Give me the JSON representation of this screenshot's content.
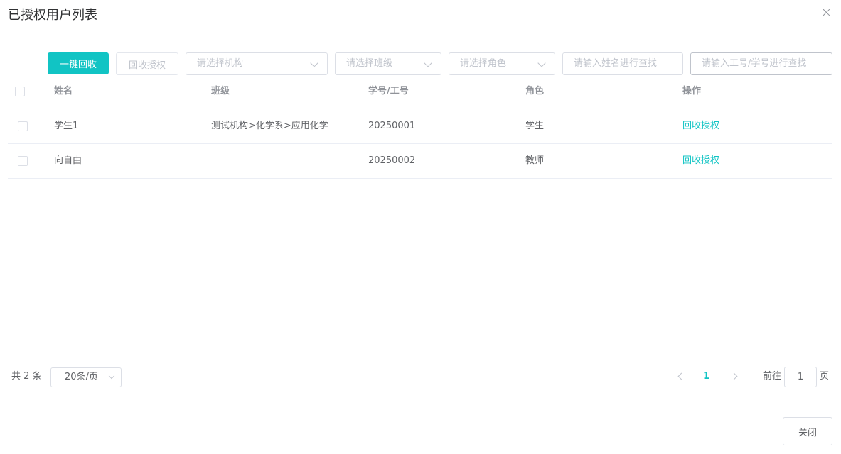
{
  "dialog": {
    "title": "已授权用户列表",
    "close_icon": "close-icon"
  },
  "toolbar": {
    "bulk_revoke_label": "一键回收",
    "revoke_label": "回收授权",
    "org_placeholder": "请选择机构",
    "class_placeholder": "请选择班级",
    "role_placeholder": "请选择角色",
    "name_search_placeholder": "请输入姓名进行查找",
    "id_search_placeholder": "请输入工号/学号进行查找"
  },
  "table": {
    "headers": {
      "name": "姓名",
      "class": "班级",
      "id": "学号/工号",
      "role": "角色",
      "action": "操作"
    },
    "rows": [
      {
        "name": "学生1",
        "class": "测试机构>化学系>应用化学",
        "id": "20250001",
        "role": "学生",
        "action": "回收授权"
      },
      {
        "name": "向自由",
        "class": "",
        "id": "20250002",
        "role": "教师",
        "action": "回收授权"
      }
    ]
  },
  "pagination": {
    "total_label": "共 2 条",
    "page_size": "20条/页",
    "current_page": "1",
    "goto_prefix": "前往",
    "goto_value": "1",
    "goto_suffix": "页"
  },
  "footer": {
    "close_label": "关闭"
  },
  "colors": {
    "accent": "#11c4c4",
    "border": "#dcdfe6",
    "placeholder": "#c0c4cc"
  }
}
